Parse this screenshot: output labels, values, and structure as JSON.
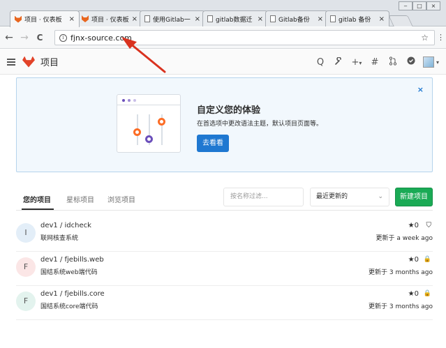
{
  "browser": {
    "tabs": [
      {
        "label": "项目 · 仪表板",
        "icon": "gitlab-fox-icon",
        "active": true
      },
      {
        "label": "项目 · 仪表板",
        "icon": "gitlab-fox-icon",
        "active": false
      },
      {
        "label": "使用Gitlab一",
        "icon": "document-icon",
        "active": false
      },
      {
        "label": "gitlab数据迁",
        "icon": "document-icon",
        "active": false
      },
      {
        "label": "Gitlab备份",
        "icon": "document-icon",
        "active": false
      },
      {
        "label": "gitlab 备份",
        "icon": "document-icon",
        "active": false
      }
    ],
    "tab_close": "×",
    "url": "fjnx-source.com",
    "back": "←",
    "forward": "→",
    "reload": "C",
    "info": "i",
    "star": "☆",
    "menu": "⋮",
    "window_buttons": [
      "‒",
      "□",
      "×"
    ]
  },
  "header": {
    "title": "项目",
    "icons": [
      "search-icon",
      "wrench-icon",
      "plus-icon",
      "hash-icon",
      "merge-request-icon",
      "todo-check-icon",
      "avatar"
    ],
    "search_glyph": "Q",
    "wrench_glyph": "🔧",
    "plus_glyph": "+",
    "plus_caret": "▾",
    "hash_glyph": "#",
    "mr_glyph": "⇅",
    "check_glyph": "✔",
    "avatar_caret": "▾"
  },
  "banner": {
    "title": "自定义您的体验",
    "text": "在首选项中更改语法主题，默认项目页面等。",
    "button": "去看看",
    "close": "×"
  },
  "projects_nav": {
    "tabs": [
      "您的项目",
      "星标项目",
      "浏览项目"
    ],
    "filter_placeholder": "按名称过滤...",
    "sort_value": "最近更新的",
    "sort_caret": "⌄",
    "new_button": "新建项目"
  },
  "projects": [
    {
      "avatar": "I",
      "avatar_color": "#e3eef8",
      "name": "dev1 / idcheck",
      "description": "联网核查系统",
      "stars": "★0",
      "visibility": "shield-icon",
      "visibility_glyph": "⛉",
      "updated": "更新于 a week ago"
    },
    {
      "avatar": "F",
      "avatar_color": "#fbe6e6",
      "name": "dev1 / fjebills.web",
      "description": "国结系统web端代码",
      "stars": "★0",
      "visibility": "lock-icon",
      "visibility_glyph": "🔒",
      "updated": "更新于 3 months ago"
    },
    {
      "avatar": "F",
      "avatar_color": "#e3f3ee",
      "name": "dev1 / fjebills.core",
      "description": "国结系统core端代码",
      "stars": "★0",
      "visibility": "lock-icon",
      "visibility_glyph": "🔒",
      "updated": "更新于 3 months ago"
    }
  ],
  "colors": {
    "primary": "#1f78d1",
    "success": "#1aaa55",
    "gitlab_orange": "#e24329",
    "annotation_arrow": "#d9321f"
  }
}
